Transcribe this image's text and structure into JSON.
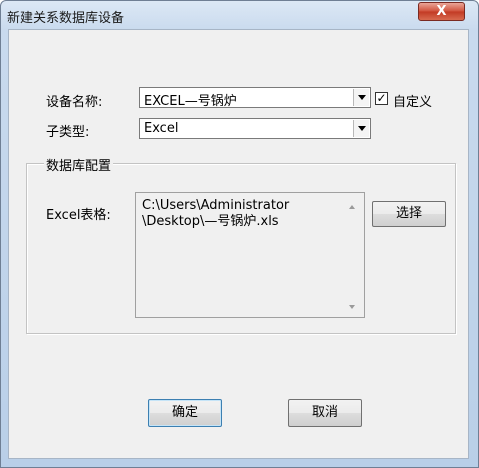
{
  "window": {
    "title": "新建关系数据库设备",
    "close_glyph": "X"
  },
  "device_name": {
    "label": "设备名称:",
    "value": "EXCEL—号锅炉"
  },
  "custom_checkbox": {
    "label": "自定义",
    "checked": true,
    "check_glyph": "✓"
  },
  "subtype": {
    "label": "子类型:",
    "value": "Excel"
  },
  "db_config": {
    "group_label": "数据库配置",
    "excel_label": "Excel表格:",
    "path_value": "C:\\Users\\Administrator\n\\Desktop\\—号锅炉.xls",
    "select_button": "选择"
  },
  "buttons": {
    "ok": "确定",
    "cancel": "取消"
  }
}
